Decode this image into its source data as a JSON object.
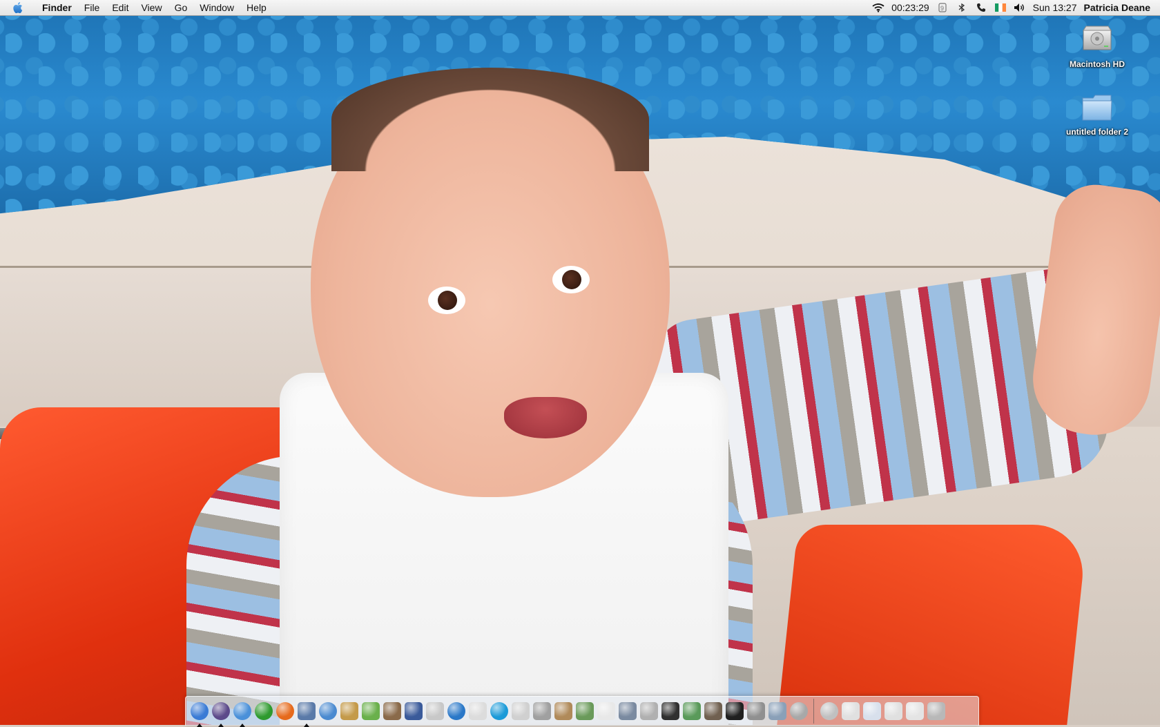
{
  "menubar": {
    "app_name": "Finder",
    "menus": [
      "File",
      "Edit",
      "View",
      "Go",
      "Window",
      "Help"
    ],
    "status": {
      "timer": "00:23:29",
      "clock": "Sun 13:27",
      "user": "Patricia Deane",
      "icons": [
        "wifi-icon",
        "timer-icon",
        "bluetooth-icon",
        "phone-icon",
        "flag-icon",
        "volume-icon"
      ]
    }
  },
  "desktop": {
    "icons": [
      {
        "label": "Macintosh HD",
        "icon": "hard-drive-icon"
      },
      {
        "label": "untitled folder 2",
        "icon": "folder-icon"
      }
    ]
  },
  "dock": {
    "apps": [
      {
        "icon": "finder-icon",
        "color": "#3a7bd5",
        "running": true
      },
      {
        "icon": "dashboard-icon",
        "color": "#5c4a8a",
        "running": true
      },
      {
        "icon": "safari-icon",
        "color": "#4a90d9",
        "running": true
      },
      {
        "icon": "green-app-icon",
        "color": "#2e9a2e",
        "running": false
      },
      {
        "icon": "firefox-icon",
        "color": "#e66a1c",
        "running": false
      },
      {
        "icon": "preview-icon",
        "color": "#5a7aa8",
        "running": true
      },
      {
        "icon": "ichat-icon",
        "color": "#4a8ad0",
        "running": false
      },
      {
        "icon": "address-book-icon",
        "color": "#c49a4a",
        "running": false
      },
      {
        "icon": "itunes-icon",
        "color": "#6ab04c",
        "running": false
      },
      {
        "icon": "iphoto-icon",
        "color": "#8a6a4a",
        "running": false
      },
      {
        "icon": "imovie-icon",
        "color": "#3a5a9a",
        "running": false
      },
      {
        "icon": "grid-app-icon",
        "color": "#c8c8c8",
        "running": false
      },
      {
        "icon": "idvd-icon",
        "color": "#2a78c8",
        "running": false
      },
      {
        "icon": "textedit-icon",
        "color": "#dcdcdc",
        "running": false
      },
      {
        "icon": "quicktime-icon",
        "color": "#1a9ad8",
        "running": false
      },
      {
        "icon": "system-icon",
        "color": "#d0d0d0",
        "running": false
      },
      {
        "icon": "utility-icon",
        "color": "#a0a0a0",
        "running": false
      },
      {
        "icon": "scissors-icon",
        "color": "#b08a5a",
        "running": false
      },
      {
        "icon": "chart-app-icon",
        "color": "#6a9a5a",
        "running": false
      },
      {
        "icon": "ical-icon",
        "color": "#e8e8e8",
        "running": false
      },
      {
        "icon": "photo-viewer-icon",
        "color": "#7a8aa0",
        "running": false
      },
      {
        "icon": "printer-icon",
        "color": "#b0b0b0",
        "running": false
      },
      {
        "icon": "tuxedo-icon",
        "color": "#303030",
        "running": false
      },
      {
        "icon": "book-icon",
        "color": "#5a9a5a",
        "running": false
      },
      {
        "icon": "hammer-icon",
        "color": "#706050",
        "running": false
      },
      {
        "icon": "activity-monitor-icon",
        "color": "#202020",
        "running": false
      },
      {
        "icon": "calculator-icon",
        "color": "#909090",
        "running": false
      },
      {
        "icon": "network-icon",
        "color": "#8aa0b8",
        "running": false
      },
      {
        "icon": "disk-utility-icon",
        "color": "#a8a8a8",
        "running": false
      }
    ],
    "right": [
      {
        "icon": "hard-disk-icon",
        "color": "#c0c0c0"
      },
      {
        "icon": "window-minimized-1-icon",
        "color": "#e0e0e0"
      },
      {
        "icon": "window-minimized-2-icon",
        "color": "#d8e0ec"
      },
      {
        "icon": "window-minimized-3-icon",
        "color": "#e0e0e0"
      },
      {
        "icon": "window-minimized-4-icon",
        "color": "#e4e4e4"
      },
      {
        "icon": "trash-icon",
        "color": "#b8b8b8"
      }
    ]
  }
}
